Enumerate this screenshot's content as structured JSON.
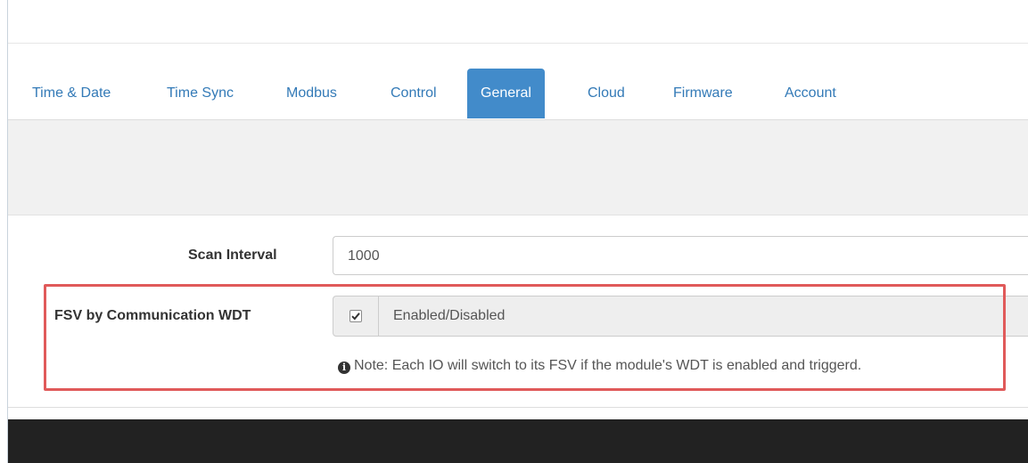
{
  "tabs": [
    {
      "label": "Time & Date",
      "active": false
    },
    {
      "label": "Time Sync",
      "active": false
    },
    {
      "label": "Modbus",
      "active": false
    },
    {
      "label": "Control",
      "active": false
    },
    {
      "label": "General",
      "active": true
    },
    {
      "label": "Cloud",
      "active": false
    },
    {
      "label": "Firmware",
      "active": false
    },
    {
      "label": "Account",
      "active": false
    }
  ],
  "form": {
    "scan_interval_label": "Scan Interval",
    "scan_interval_value": "1000",
    "fsv_label": "FSV by Communication WDT",
    "fsv_checked": true,
    "fsv_text": "Enabled/Disabled",
    "note": "Note: Each IO will switch to its FSV if the module's WDT is enabled and triggerd."
  },
  "colors": {
    "tab_active_bg": "#428bca",
    "tab_link": "#337ab7",
    "highlight_border": "#e05a5a",
    "footer": "#222222"
  },
  "icons": {
    "checkbox": "check-icon",
    "note": "info-circle-icon"
  }
}
